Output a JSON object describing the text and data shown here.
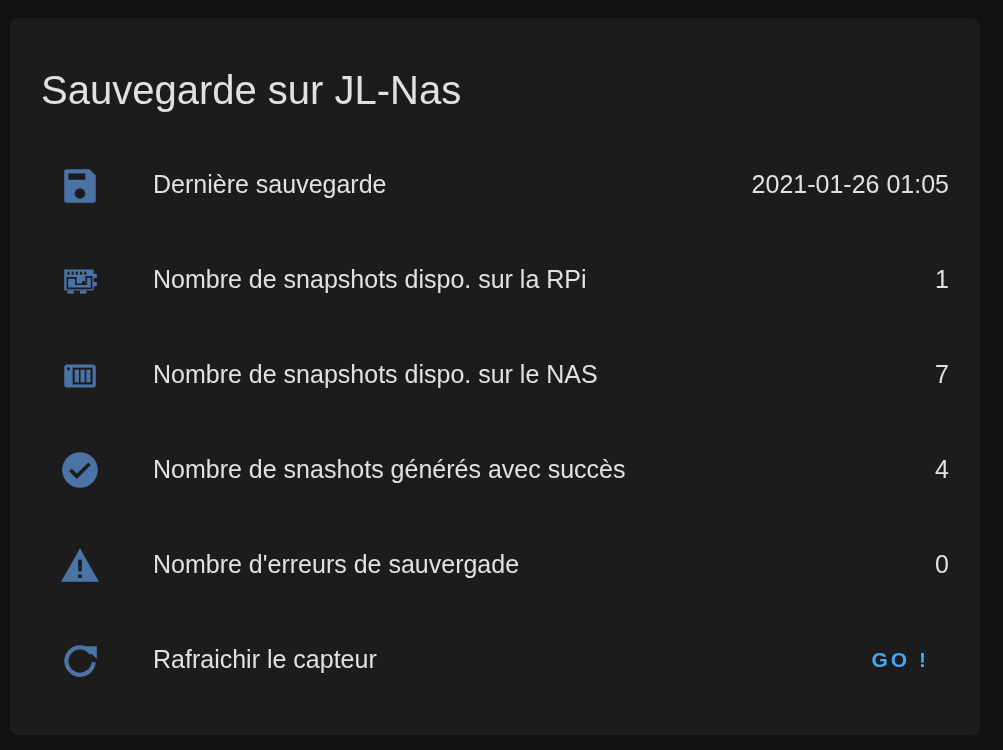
{
  "card": {
    "title": "Sauvegarde sur JL-Nas",
    "rows": [
      {
        "kind": "sensor",
        "label": "Dernière sauvegarde",
        "value": "2021-01-26 01:05"
      },
      {
        "kind": "sensor",
        "label": "Nombre de snapshots dispo. sur la RPi",
        "value": "1"
      },
      {
        "kind": "sensor",
        "label": "Nombre de snapshots dispo. sur le NAS",
        "value": "7"
      },
      {
        "kind": "sensor",
        "label": "Nombre de snashots générés avec succès",
        "value": "4"
      },
      {
        "kind": "sensor",
        "label": "Nombre d'erreurs de sauvergade",
        "value": "0"
      },
      {
        "kind": "button",
        "label": "Rafraichir le capteur",
        "value": "GO !"
      }
    ]
  }
}
